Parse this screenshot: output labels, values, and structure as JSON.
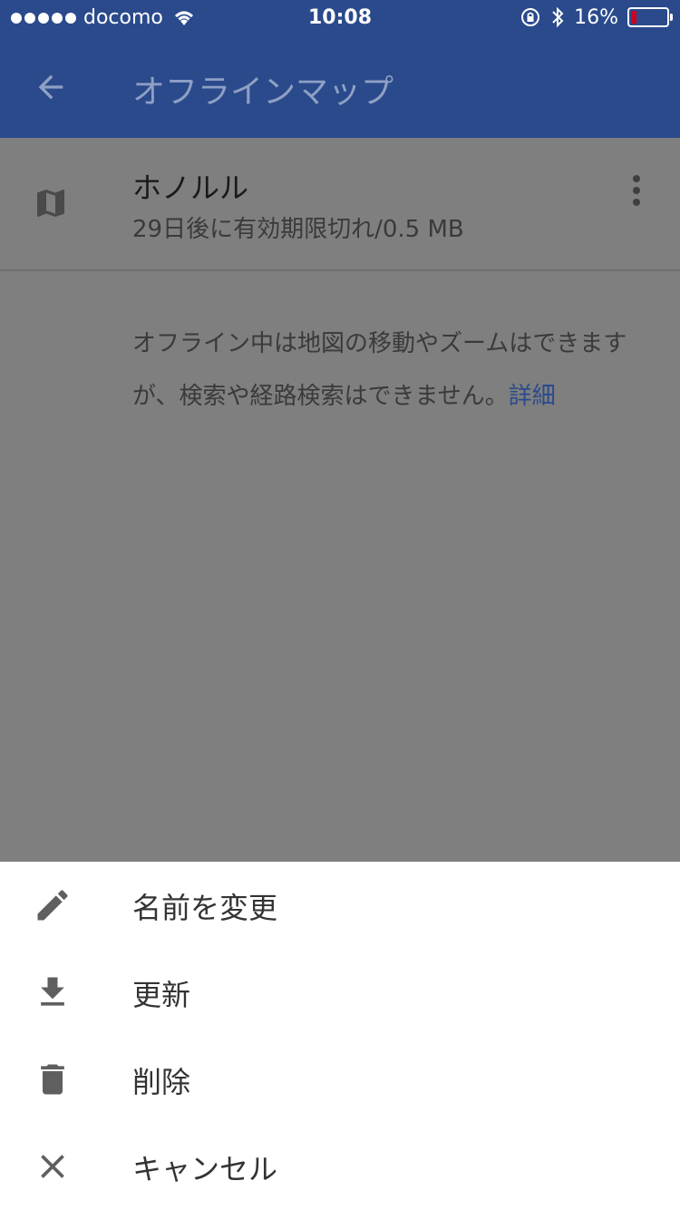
{
  "status_bar": {
    "carrier": "docomo",
    "time": "10:08",
    "battery_percent": "16%",
    "battery_level": 0.16,
    "battery_color": "#d0021b"
  },
  "app_bar": {
    "title": "オフラインマップ",
    "color": "#2a4a8c"
  },
  "offline_map": {
    "name": "ホノルル",
    "subtitle": "29日後に有効期限切れ/0.5 MB"
  },
  "info": {
    "text": "オフライン中は地図の移動やズームはできますが、検索や経路検索はできません。",
    "link": "詳細"
  },
  "bottom_sheet": {
    "items": [
      {
        "label": "名前を変更",
        "icon": "pencil-icon"
      },
      {
        "label": "更新",
        "icon": "download-icon"
      },
      {
        "label": "削除",
        "icon": "trash-icon"
      },
      {
        "label": "キャンセル",
        "icon": "close-icon"
      }
    ]
  }
}
